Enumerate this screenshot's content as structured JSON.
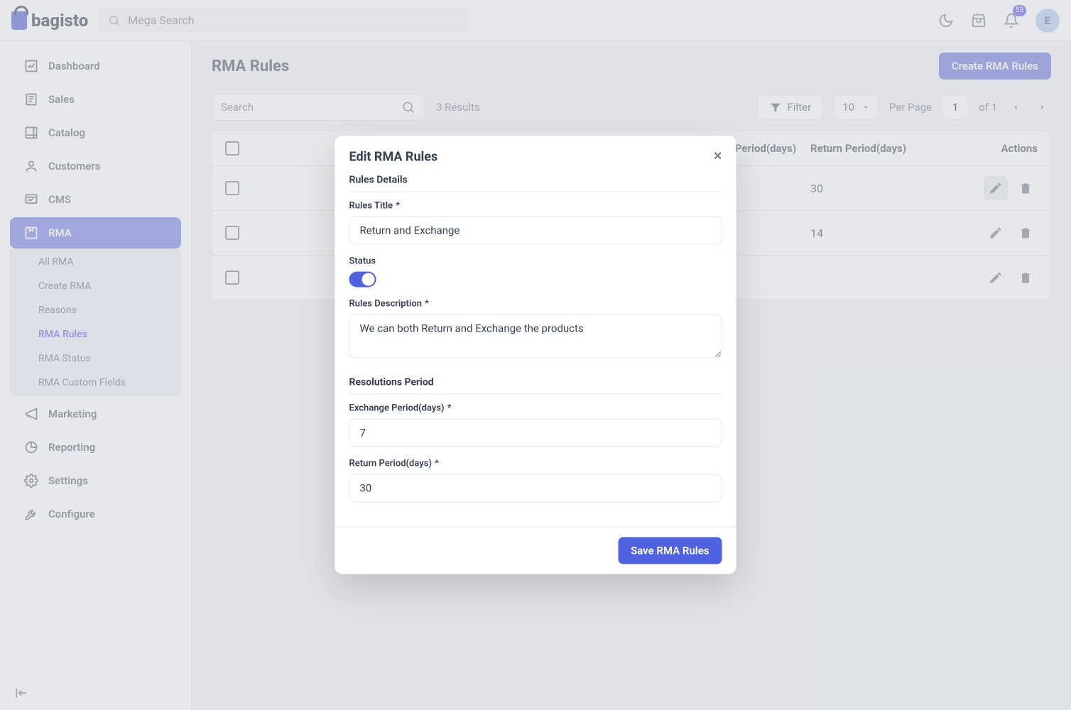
{
  "brand": "bagisto",
  "mega_search_placeholder": "Mega Search",
  "notification_count": "53",
  "avatar_letter": "E",
  "sidebar": {
    "items": [
      {
        "label": "Dashboard"
      },
      {
        "label": "Sales"
      },
      {
        "label": "Catalog"
      },
      {
        "label": "Customers"
      },
      {
        "label": "CMS"
      },
      {
        "label": "RMA"
      },
      {
        "label": "Marketing"
      },
      {
        "label": "Reporting"
      },
      {
        "label": "Settings"
      },
      {
        "label": "Configure"
      }
    ],
    "rma_sub": [
      {
        "label": "All RMA"
      },
      {
        "label": "Create RMA"
      },
      {
        "label": "Reasons"
      },
      {
        "label": "RMA Rules"
      },
      {
        "label": "RMA Status"
      },
      {
        "label": "RMA Custom Fields"
      }
    ]
  },
  "page": {
    "title": "RMA Rules",
    "create_btn": "Create RMA Rules",
    "search_placeholder": "Search",
    "results": "3 Results",
    "filter": "Filter",
    "per_page_value": "10",
    "per_page_label": "Per Page",
    "page_value": "1",
    "of_label": "of 1"
  },
  "table": {
    "headers": {
      "exchange": "e Period(days)",
      "return": "Return Period(days)",
      "actions": "Actions"
    },
    "rows": [
      {
        "return": "30"
      },
      {
        "return": "14"
      },
      {
        "return": ""
      }
    ]
  },
  "modal": {
    "title": "Edit RMA Rules",
    "section_details": "Rules Details",
    "section_resolutions": "Resolutions Period",
    "labels": {
      "title": "Rules Title",
      "status": "Status",
      "description": "Rules Description",
      "exchange": "Exchange Period(days)",
      "return": "Return Period(days)"
    },
    "values": {
      "title": "Return and Exchange",
      "description": "We can both Return and Exchange the products",
      "exchange": "7",
      "return": "30"
    },
    "save_btn": "Save RMA Rules"
  }
}
